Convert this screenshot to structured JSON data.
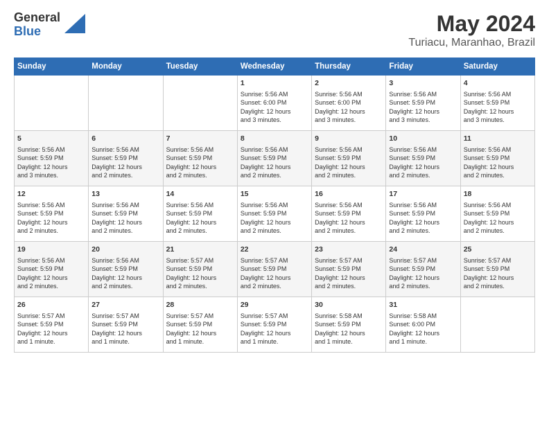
{
  "header": {
    "logo_general": "General",
    "logo_blue": "Blue",
    "title": "May 2024",
    "subtitle": "Turiacu, Maranhao, Brazil"
  },
  "days_of_week": [
    "Sunday",
    "Monday",
    "Tuesday",
    "Wednesday",
    "Thursday",
    "Friday",
    "Saturday"
  ],
  "weeks": [
    [
      {
        "day": "",
        "info": ""
      },
      {
        "day": "",
        "info": ""
      },
      {
        "day": "",
        "info": ""
      },
      {
        "day": "1",
        "info": "Sunrise: 5:56 AM\nSunset: 6:00 PM\nDaylight: 12 hours\nand 3 minutes."
      },
      {
        "day": "2",
        "info": "Sunrise: 5:56 AM\nSunset: 6:00 PM\nDaylight: 12 hours\nand 3 minutes."
      },
      {
        "day": "3",
        "info": "Sunrise: 5:56 AM\nSunset: 5:59 PM\nDaylight: 12 hours\nand 3 minutes."
      },
      {
        "day": "4",
        "info": "Sunrise: 5:56 AM\nSunset: 5:59 PM\nDaylight: 12 hours\nand 3 minutes."
      }
    ],
    [
      {
        "day": "5",
        "info": "Sunrise: 5:56 AM\nSunset: 5:59 PM\nDaylight: 12 hours\nand 3 minutes."
      },
      {
        "day": "6",
        "info": "Sunrise: 5:56 AM\nSunset: 5:59 PM\nDaylight: 12 hours\nand 2 minutes."
      },
      {
        "day": "7",
        "info": "Sunrise: 5:56 AM\nSunset: 5:59 PM\nDaylight: 12 hours\nand 2 minutes."
      },
      {
        "day": "8",
        "info": "Sunrise: 5:56 AM\nSunset: 5:59 PM\nDaylight: 12 hours\nand 2 minutes."
      },
      {
        "day": "9",
        "info": "Sunrise: 5:56 AM\nSunset: 5:59 PM\nDaylight: 12 hours\nand 2 minutes."
      },
      {
        "day": "10",
        "info": "Sunrise: 5:56 AM\nSunset: 5:59 PM\nDaylight: 12 hours\nand 2 minutes."
      },
      {
        "day": "11",
        "info": "Sunrise: 5:56 AM\nSunset: 5:59 PM\nDaylight: 12 hours\nand 2 minutes."
      }
    ],
    [
      {
        "day": "12",
        "info": "Sunrise: 5:56 AM\nSunset: 5:59 PM\nDaylight: 12 hours\nand 2 minutes."
      },
      {
        "day": "13",
        "info": "Sunrise: 5:56 AM\nSunset: 5:59 PM\nDaylight: 12 hours\nand 2 minutes."
      },
      {
        "day": "14",
        "info": "Sunrise: 5:56 AM\nSunset: 5:59 PM\nDaylight: 12 hours\nand 2 minutes."
      },
      {
        "day": "15",
        "info": "Sunrise: 5:56 AM\nSunset: 5:59 PM\nDaylight: 12 hours\nand 2 minutes."
      },
      {
        "day": "16",
        "info": "Sunrise: 5:56 AM\nSunset: 5:59 PM\nDaylight: 12 hours\nand 2 minutes."
      },
      {
        "day": "17",
        "info": "Sunrise: 5:56 AM\nSunset: 5:59 PM\nDaylight: 12 hours\nand 2 minutes."
      },
      {
        "day": "18",
        "info": "Sunrise: 5:56 AM\nSunset: 5:59 PM\nDaylight: 12 hours\nand 2 minutes."
      }
    ],
    [
      {
        "day": "19",
        "info": "Sunrise: 5:56 AM\nSunset: 5:59 PM\nDaylight: 12 hours\nand 2 minutes."
      },
      {
        "day": "20",
        "info": "Sunrise: 5:56 AM\nSunset: 5:59 PM\nDaylight: 12 hours\nand 2 minutes."
      },
      {
        "day": "21",
        "info": "Sunrise: 5:57 AM\nSunset: 5:59 PM\nDaylight: 12 hours\nand 2 minutes."
      },
      {
        "day": "22",
        "info": "Sunrise: 5:57 AM\nSunset: 5:59 PM\nDaylight: 12 hours\nand 2 minutes."
      },
      {
        "day": "23",
        "info": "Sunrise: 5:57 AM\nSunset: 5:59 PM\nDaylight: 12 hours\nand 2 minutes."
      },
      {
        "day": "24",
        "info": "Sunrise: 5:57 AM\nSunset: 5:59 PM\nDaylight: 12 hours\nand 2 minutes."
      },
      {
        "day": "25",
        "info": "Sunrise: 5:57 AM\nSunset: 5:59 PM\nDaylight: 12 hours\nand 2 minutes."
      }
    ],
    [
      {
        "day": "26",
        "info": "Sunrise: 5:57 AM\nSunset: 5:59 PM\nDaylight: 12 hours\nand 1 minute."
      },
      {
        "day": "27",
        "info": "Sunrise: 5:57 AM\nSunset: 5:59 PM\nDaylight: 12 hours\nand 1 minute."
      },
      {
        "day": "28",
        "info": "Sunrise: 5:57 AM\nSunset: 5:59 PM\nDaylight: 12 hours\nand 1 minute."
      },
      {
        "day": "29",
        "info": "Sunrise: 5:57 AM\nSunset: 5:59 PM\nDaylight: 12 hours\nand 1 minute."
      },
      {
        "day": "30",
        "info": "Sunrise: 5:58 AM\nSunset: 5:59 PM\nDaylight: 12 hours\nand 1 minute."
      },
      {
        "day": "31",
        "info": "Sunrise: 5:58 AM\nSunset: 6:00 PM\nDaylight: 12 hours\nand 1 minute."
      },
      {
        "day": "",
        "info": ""
      }
    ]
  ]
}
